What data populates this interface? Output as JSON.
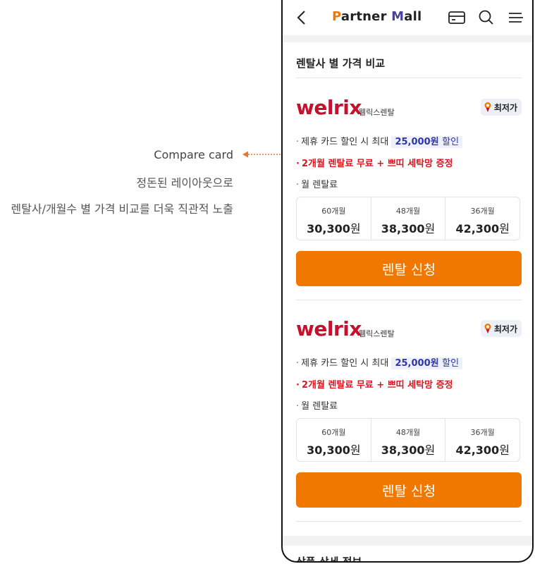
{
  "annotation": {
    "title": "Compare card",
    "line1": "정돈된 레이아웃으로",
    "line2": "렌탈사/개월수 별 가격 비교를 더욱 직관적 노출",
    "color": "#e8743a"
  },
  "header": {
    "title_p": "P",
    "title_rest1": "artner ",
    "title_m": "M",
    "title_rest2": "all",
    "icons": [
      "back-icon",
      "card-icon",
      "search-icon",
      "menu-icon"
    ]
  },
  "section": {
    "title": "렌탈사 별 가격 비교"
  },
  "cards": [
    {
      "logo": "welrix",
      "logo_sub": "웰릭스렌탈",
      "badge": "최저가",
      "benefit_prefix": "제휴 카드 할인 시 최대",
      "benefit_amount": "25,000원",
      "benefit_suffix": "할인",
      "promo": "2개월 렌탈료 무료 + 쁘띠 세탁망 증정",
      "monthly_label": "월 렌탈료",
      "prices": [
        {
          "term": "60개월",
          "amount": "30,300",
          "unit": "원"
        },
        {
          "term": "48개월",
          "amount": "38,300",
          "unit": "원"
        },
        {
          "term": "36개월",
          "amount": "42,300",
          "unit": "원"
        }
      ],
      "button": "렌탈 신청"
    },
    {
      "logo": "welrix",
      "logo_sub": "웰릭스렌탈",
      "badge": "최저가",
      "benefit_prefix": "제휴 카드 할인 시 최대",
      "benefit_amount": "25,000원",
      "benefit_suffix": "할인",
      "promo": "2개월 렌탈료 무료 + 쁘띠 세탁망 증정",
      "monthly_label": "월 렌탈료",
      "prices": [
        {
          "term": "60개월",
          "amount": "30,300",
          "unit": "원"
        },
        {
          "term": "48개월",
          "amount": "38,300",
          "unit": "원"
        },
        {
          "term": "36개월",
          "amount": "42,300",
          "unit": "원"
        }
      ],
      "button": "렌탈 신청"
    }
  ],
  "next_section": {
    "title": "상품 상세 정보"
  },
  "colors": {
    "brand_orange": "#f07800",
    "brand_purple": "#4b3fa0",
    "logo_red": "#c8102e",
    "promo_red": "#e0141e",
    "highlight_blue": "#2e36a8"
  }
}
